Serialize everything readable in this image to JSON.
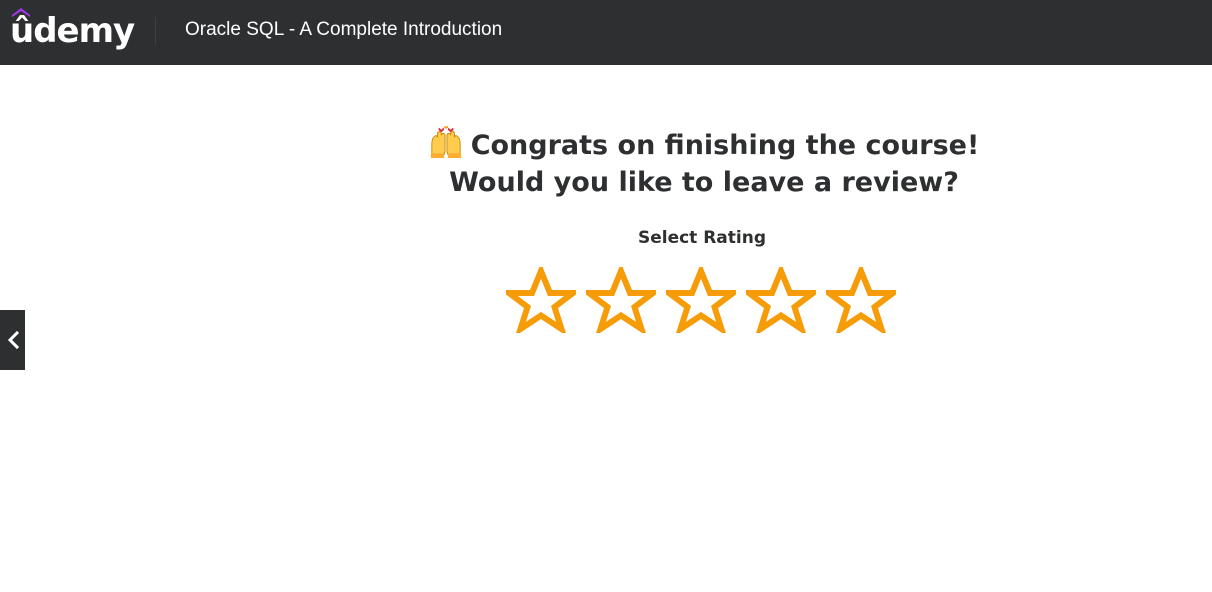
{
  "header": {
    "logo_text": "ûdemy",
    "course_title": "Oracle SQL - A Complete Introduction"
  },
  "colors": {
    "header_bg": "#2d2f31",
    "brand_purple": "#a435f0",
    "star_color": "#f69c08",
    "text_dark": "#2d2f31"
  },
  "main": {
    "headline_line1": "Congrats on finishing the course!",
    "headline_line2": "Would you like to leave a review?",
    "emoji": "raising-hands-emoji",
    "rating_label": "Select Rating",
    "stars": [
      {
        "label": "1 star",
        "filled": false
      },
      {
        "label": "2 stars",
        "filled": false
      },
      {
        "label": "3 stars",
        "filled": false
      },
      {
        "label": "4 stars",
        "filled": false
      },
      {
        "label": "5 stars",
        "filled": false
      }
    ],
    "selected_rating": 0,
    "max_rating": 5
  },
  "nav": {
    "prev_icon": "chevron-left-icon"
  }
}
